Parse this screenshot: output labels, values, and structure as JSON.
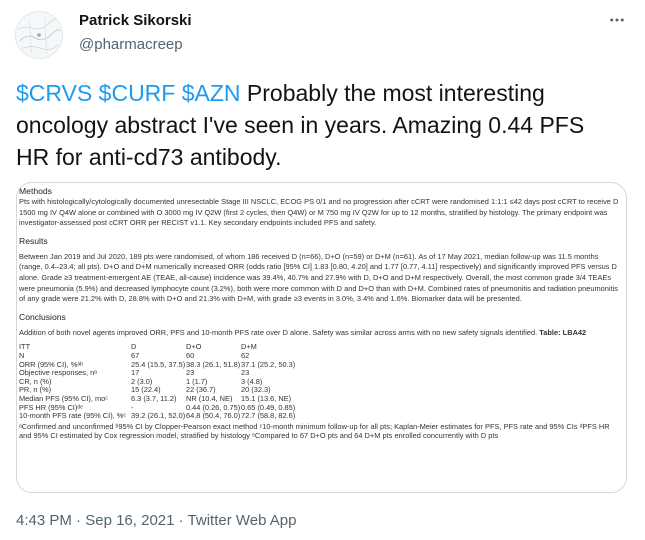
{
  "tweet": {
    "author_name": "Patrick Sikorski",
    "author_handle": "@pharmacreep",
    "cashtags": [
      "$CRVS",
      "$CURF",
      "$AZN"
    ],
    "text": "Probably the most interesting oncology abstract I've seen in years. Amazing 0.44 PFS HR for anti-cd73 antibody.",
    "time": "4:43 PM",
    "date": "Sep 16, 2021",
    "source": "Twitter Web App",
    "separator": "·"
  },
  "abstract": {
    "methods_title": "Methods",
    "methods_text": "Pts with histologically/cytologically documented unresectable Stage III NSCLC, ECOG PS 0/1 and no progression after cCRT were randomised 1:1:1 ≤42 days post cCRT to receive D 1500 mg IV Q4W alone or combined with O 3000 mg IV Q2W (first 2 cycles, then Q4W) or M 750 mg IV Q2W for up to 12 months, stratified by histology. The primary endpoint was investigator-assessed post cCRT ORR per RECIST v1.1. Key secondary endpoints included PFS and safety.",
    "results_title": "Results",
    "results_text": "Between Jan 2019 and Jul 2020, 189 pts were randomised, of whom 186 received D (n=66), D+O (n=59) or D+M (n=61). As of 17 May 2021, median follow-up was 11.5 months (range, 0.4–23.4; all pts). D+O and D+M numerically increased ORR (odds ratio [95% CI] 1.83 [0.80, 4.20] and 1.77 [0.77, 4.11] respectively) and significantly improved PFS versus D alone. Grade ≥3 treatment-emergent AE (TEAE, all-cause) incidence was 39.4%, 40.7% and 27.9% with D, D+O and D+M respectively. Overall, the most common grade 3/4 TEAEs were pneumonia (5.9%) and decreased lymphocyte count (3.2%), both were more common with D and D+O than with D+M. Combined rates of pneumonitis and radiation pneumonitis of any grade were 21.2% with D, 28.8% with D+O and 21.3% with D+M, with grade ≥3 events in 3.0%, 3.4% and 1.6%. Biomarker data will be presented.",
    "conclusions_title": "Conclusions",
    "conclusions_text": "Addition of both novel agents improved ORR, PFS and 10-month PFS rate over D alone. Safety was similar across arms with no new safety signals identified.",
    "table_label": "Table: LBA42",
    "table": {
      "headers": [
        "ITT",
        "D",
        "D+O",
        "D+M"
      ],
      "rows": [
        [
          "N",
          "67",
          "60",
          "62"
        ],
        [
          "ORR (95% CI), %ᵃᵇ",
          "25.4 (15.5, 37.5)",
          "38.3 (26.1, 51.8)",
          "37.1 (25.2, 50.3)"
        ],
        [
          "Objective responses, nᵃ",
          "17",
          "23",
          "23"
        ],
        [
          "CR, n (%)",
          "2 (3.0)",
          "1 (1.7)",
          "3 (4.8)"
        ],
        [
          "PR, n (%)",
          "15 (22.4)",
          "22 (36.7)",
          "20 (32.3)"
        ],
        [
          "Median PFS (95% CI), moᶜ",
          "6.3 (3.7, 11.2)",
          "NR (10.4, NE)",
          "15.1 (13.6, NE)"
        ],
        [
          "PFS HR (95% CI)ᵈᵉ",
          "-",
          "0.44 (0.26, 0.75)",
          "0.65 (0.49, 0.85)"
        ],
        [
          "10-month PFS rate (95% CI), %ᶜ",
          "39.2 (26.1, 52.0)",
          "64.8 (50.4, 76.0)",
          "72.7 (58.8, 82.6)"
        ]
      ],
      "footnote": "ᵃConfirmed and unconfirmed ᵇ95% CI by Clopper-Pearson exact method ᶜ10-month minimum follow-up for all pts; Kaplan-Meier estimates for PFS, PFS rate and 95% CIs ᵈPFS HR and 95% CI estimated by Cox regression model, stratified by histology ᵉCompared to 67 D+O pts and 64 D+M pts enrolled concurrently with D pts"
    }
  },
  "icons": {
    "more": "more-horizontal-icon",
    "avatar": "avatar-map-sketch"
  },
  "colors": {
    "text": "#0f1419",
    "secondary": "#536471",
    "link": "#1d9bf0",
    "border": "#cfd9de"
  }
}
